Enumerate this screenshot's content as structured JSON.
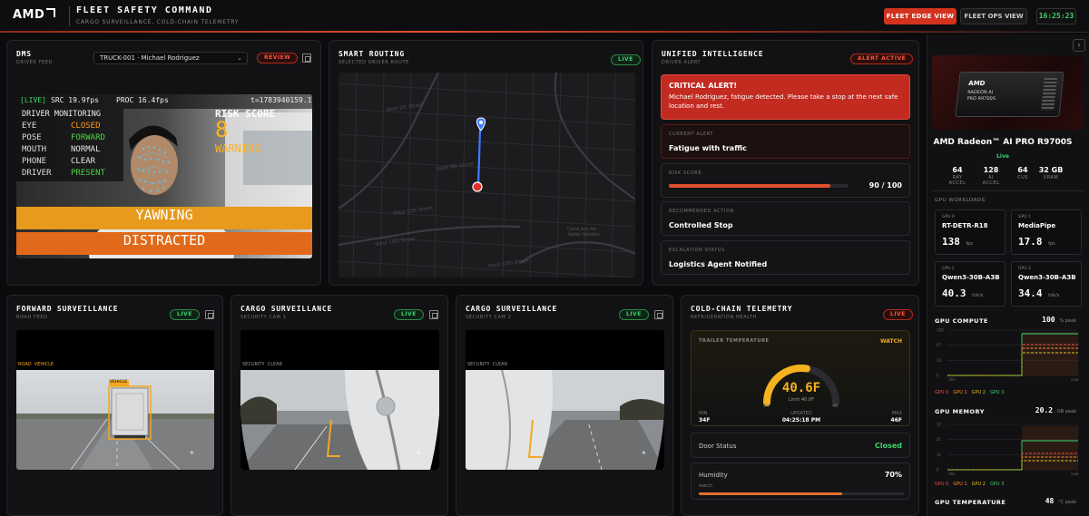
{
  "header": {
    "logo": "AMD",
    "title": "FLEET SAFETY COMMAND",
    "subtitle": "CARGO SURVEILLANCE, COLD-CHAIN TELEMETRY",
    "edge_view_label": "FLEET EDGE VIEW",
    "ops_view_label": "FLEET OPS VIEW",
    "clock": "16:25:23"
  },
  "dms": {
    "title": "DMS",
    "subtitle": "DRIVER FEED",
    "driver_select": "TRUCK-001 · Michael Rodriguez",
    "badge": "REVIEW",
    "overlay": {
      "live_tag": "[LIVE]",
      "src": "SRC 19.9fps",
      "proc": "PROC 16.4fps",
      "timestamp": "t=1783940159.1",
      "monitoring_label": "DRIVER MONITORING",
      "rows": [
        {
          "key": "EYE",
          "value": "CLOSED",
          "color": "#ff9a1f"
        },
        {
          "key": "POSE",
          "value": "FORWARD",
          "color": "#4fd24a"
        },
        {
          "key": "MOUTH",
          "value": "NORMAL",
          "color": "#e6e6e6"
        },
        {
          "key": "PHONE",
          "value": "CLEAR",
          "color": "#e6e6e6"
        },
        {
          "key": "DRIVER",
          "value": "PRESENT",
          "color": "#4fd24a"
        }
      ],
      "risk_label": "RISK SCORE",
      "risk_value": "8",
      "risk_state": "WARNING",
      "banner_1": "YAWNING",
      "banner_2": "DISTRACTED"
    }
  },
  "routing": {
    "title": "SMART ROUTING",
    "subtitle": "SELECTED DRIVER ROUTE",
    "badge": "LIVE",
    "streets": [
      "West 2th Street",
      "West 8th Street",
      "West 11th Street",
      "West 14th Street",
      "West 15th Street"
    ],
    "landmark": "Canal and Joe Yeeble Gardens"
  },
  "intelligence": {
    "title": "UNIFIED INTELLIGENCE",
    "subtitle": "DRIVER ALERT",
    "badge": "ALERT ACTIVE",
    "alert_title": "CRITICAL ALERT!",
    "alert_text": "Michael Rodriguez, fatigue detected. Please take a stop at the next safe location and rest.",
    "current_alert_label": "CURRENT ALERT",
    "current_alert": "Fatigue with traffic",
    "risk_label": "RISK SCORE",
    "risk_text": "90 / 100",
    "risk_fraction": 0.9,
    "action_label": "RECOMMENDED ACTION",
    "action": "Controlled Stop",
    "escalation_label": "ESCALATION STATUS",
    "escalation": "Logistics Agent Notified"
  },
  "forward": {
    "title": "FORWARD SURVEILLANCE",
    "subtitle": "ROAD FEED",
    "badge": "LIVE",
    "tags": "ROAD  VEHICLE",
    "box_label": "VEHICLE"
  },
  "cargo1": {
    "title": "CARGO SURVEILLANCE",
    "subtitle": "SECURITY CAM 1",
    "badge": "LIVE",
    "tags": "SECURITY  CLEAR"
  },
  "cargo2": {
    "title": "CARGO SURVEILLANCE",
    "subtitle": "SECURITY CAM 2",
    "badge": "LIVE",
    "tags": "SECURITY  CLEAR"
  },
  "coldchain": {
    "title": "COLD-CHAIN TELEMETRY",
    "subtitle": "REFRIGERATION HEALTH",
    "badge": "LIVE",
    "trailer_label": "TRAILER TEMPERATURE",
    "trailer_status": "WATCH",
    "temp": "40.6F",
    "limit": "Limit 40.0F",
    "gauge_min": "34",
    "gauge_max": "46",
    "gauge_fraction": 0.55,
    "min_label": "MIN",
    "min_value": "34F",
    "updated_label": "UPDATED",
    "updated_value": "04:25:18 PM",
    "max_label": "MAX",
    "max_value": "46F",
    "door_label": "Door Status",
    "door_value": "Closed",
    "humidity_label": "Humidity",
    "humidity_value": "70%",
    "humidity_sub": "watch",
    "humidity_fraction": 0.7
  },
  "gpu": {
    "name": "AMD Radeon™ AI PRO R9700S",
    "status": "Live",
    "card_brand": "AMD",
    "card_model_1": "RADEON AI",
    "card_model_2": "PRO R9700S",
    "stats": [
      {
        "value": "64",
        "label": "RAY ACCEL"
      },
      {
        "value": "128",
        "label": "AI ACCEL"
      },
      {
        "value": "64",
        "label": "CUS"
      },
      {
        "value": "32 GB",
        "label": "VRAM"
      }
    ],
    "workloads_label": "GPU WORKLOADS",
    "workloads": [
      {
        "gpu": "GPU 0",
        "name": "RT-DETR-R18",
        "value": "138",
        "unit": "fps"
      },
      {
        "gpu": "GPU 1",
        "name": "MediaPipe",
        "value": "17.8",
        "unit": "fps"
      },
      {
        "gpu": "GPU 2",
        "name": "Qwen3-30B-A3B",
        "value": "40.3",
        "unit": "tok/s"
      },
      {
        "gpu": "GPU 3",
        "name": "Qwen3-30B-A3B",
        "value": "34.4",
        "unit": "tok/s"
      }
    ],
    "compute_label": "GPU COMPUTE",
    "compute_value": "100",
    "compute_unit": "% peak",
    "memory_label": "GPU MEMORY",
    "memory_value": "20.2",
    "memory_unit": "GB peak",
    "temp_label": "GPU TEMPERATURE",
    "temp_value": "48",
    "temp_unit": "°C peak",
    "legend": [
      "GPU 0",
      "GPU 1",
      "GPU 2",
      "GPU 3"
    ],
    "legend_colors": [
      "#ff4a3a",
      "#ff8a2a",
      "#e0c020",
      "#3fd36b"
    ],
    "axis_start": "-30s",
    "axis_end": "now",
    "compute_ticks": [
      "100",
      "67",
      "33",
      "0"
    ],
    "memory_ticks": [
      "32",
      "21",
      "11",
      "0"
    ]
  }
}
